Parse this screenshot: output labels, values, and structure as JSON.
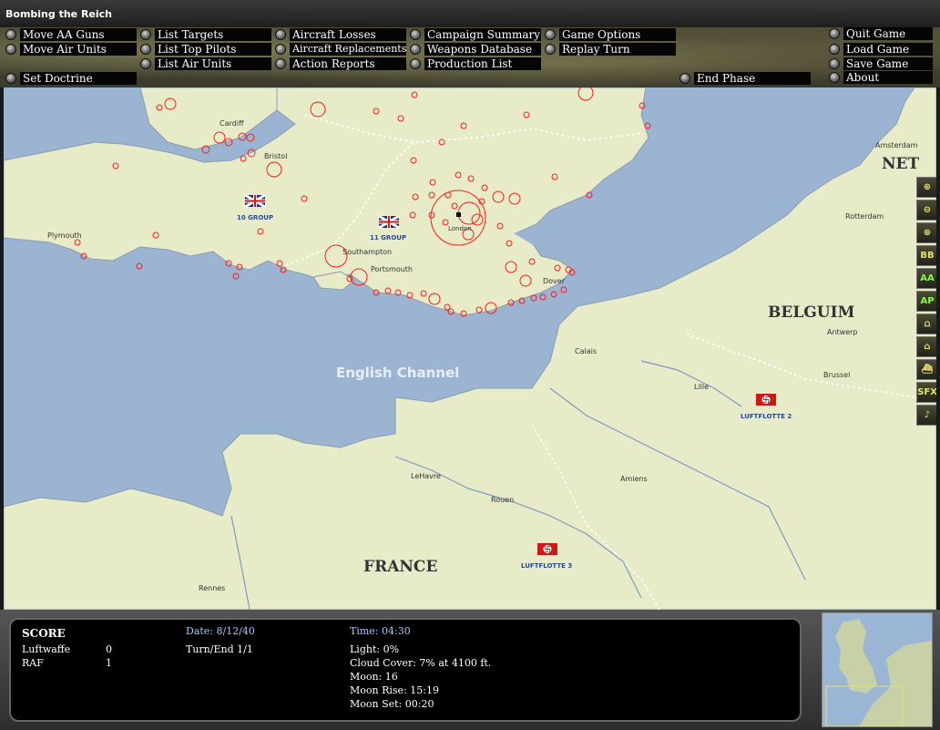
{
  "window": {
    "title": "Bombing the Reich"
  },
  "menu": {
    "move_aa_guns": "Move AA Guns",
    "move_air_units": "Move Air Units",
    "set_doctrine": "Set Doctrine",
    "list_targets": "List Targets",
    "list_top_pilots": "List Top Pilots",
    "list_air_units": "List Air Units",
    "aircraft_losses": "Aircraft Losses",
    "aircraft_replacements": "Aircraft Replacements",
    "action_reports": "Action Reports",
    "campaign_summary": "Campaign Summary",
    "weapons_database": "Weapons Database",
    "production_list": "Production List",
    "game_options": "Game Options",
    "replay_turn": "Replay Turn",
    "end_phase": "End Phase",
    "quit_game": "Quit Game",
    "load_game": "Load Game",
    "save_game": "Save Game",
    "about": "About"
  },
  "map": {
    "sea_label": "English Channel",
    "countries": {
      "france": "FRANCE",
      "belgium": "BELGUIM",
      "netherlands": "NET"
    },
    "cities": {
      "cardiff": "Cardiff",
      "bristol": "Bristol",
      "plymouth": "Plymouth",
      "southampton": "Southampton",
      "portsmouth": "Portsmouth",
      "london": "London",
      "dover": "Dover",
      "calais": "Calais",
      "lille": "Lille",
      "brussel": "Brussel",
      "antwerp": "Antwerp",
      "rotterdam": "Rotterdam",
      "amsterdam": "Amsterdam",
      "amiens": "Amiens",
      "rouen": "Rouen",
      "lehavre": "LeHavre",
      "rennes": "Rennes"
    },
    "units": {
      "group10": "10 GROUP",
      "group11": "11 GROUP",
      "luftflotte2": "LUFTFLOTTE 2",
      "luftflotte3": "LUFTFLOTTE 3"
    },
    "colors": {
      "sea": "#9ab4d2",
      "land": "#e8ebc8",
      "target": "#ff1a1a"
    }
  },
  "tools": [
    "zoom-in",
    "zoom-out",
    "center",
    "BB",
    "AA",
    "AP",
    "bridge",
    "building",
    "ship",
    "SFX",
    "music"
  ],
  "tool_labels": {
    "bb": "BB",
    "aa": "AA",
    "ap": "AP",
    "sfx": "SFX"
  },
  "info": {
    "score_title": "SCORE",
    "luftwaffe_label": "Luftwaffe",
    "luftwaffe_score": "0",
    "raf_label": "RAF",
    "raf_score": "1",
    "date": "Date: 8/12/40",
    "turn": "Turn/End 1/1",
    "time": "Time: 04:30",
    "light": "Light: 0%",
    "cloud": "Cloud Cover: 7% at 4100 ft.",
    "moon": "Moon: 16",
    "moon_rise": "Moon Rise: 15:19",
    "moon_set": "Moon Set: 00:20"
  }
}
